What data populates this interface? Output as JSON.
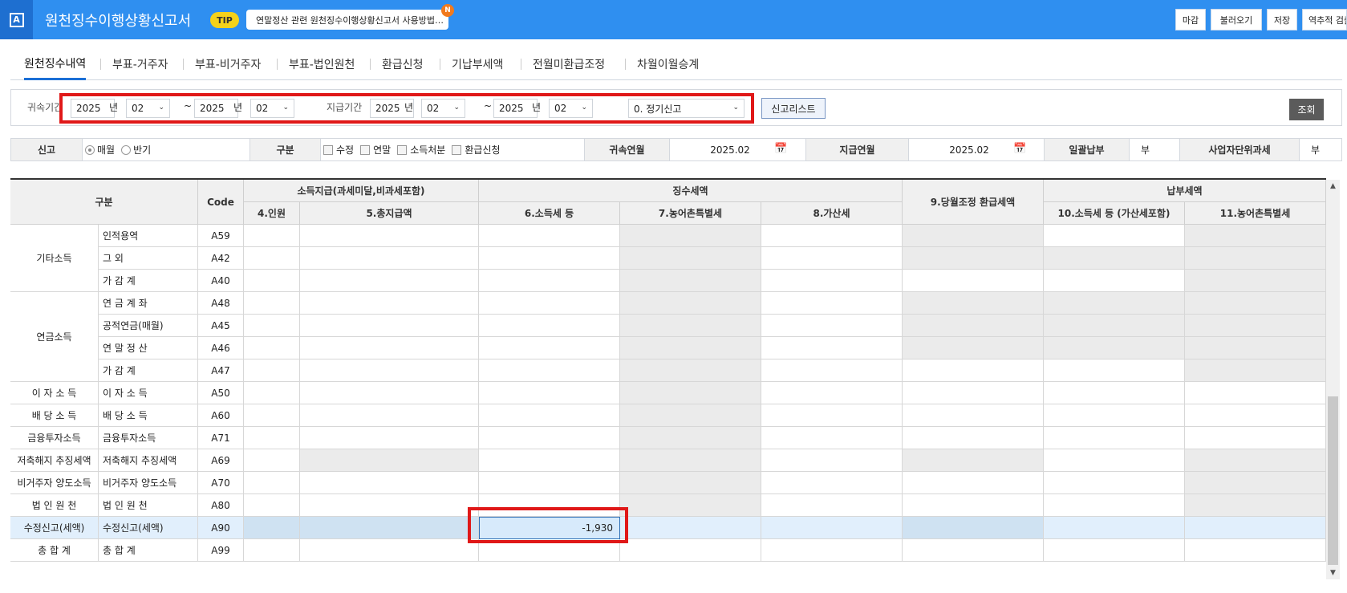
{
  "app": {
    "title": "원천징수이행상황신고서",
    "logo": "A",
    "tip_badge": "TIP",
    "tip_text": "연말정산 관련 원천징수이행상황신고서 사용방법…",
    "notice_badge": "N"
  },
  "toolbar": {
    "close_label": "마감",
    "load_label": "불러오기",
    "save_label": "저장",
    "reverse_label": "역추적 검출"
  },
  "tabs": [
    "원천징수내역",
    "부표-거주자",
    "부표-비거주자",
    "부표-법인원천",
    "환급신청",
    "기납부세액",
    "전월미환급조정",
    "차월이월승계"
  ],
  "filter": {
    "belong_label": "귀속기간",
    "year_unit": "년",
    "tilde": "~",
    "belong_from_year": "2025",
    "belong_from_month": "02",
    "belong_to_year": "2025",
    "belong_to_month": "02",
    "pay_label": "지급기간",
    "pay_from_year": "2025",
    "pay_from_month": "02",
    "pay_to_year": "2025",
    "pay_to_month": "02",
    "report_type": "0. 정기신고",
    "report_list_button": "신고리스트",
    "search_button": "조회"
  },
  "conditions": {
    "report_label": "신고",
    "monthly": "매월",
    "semiannual": "반기",
    "category_label": "구분",
    "amend": "수정",
    "yearend": "연말",
    "income_disposal": "소득처분",
    "refund": "환급신청",
    "belong_month_label": "귀속연월",
    "belong_month": "2025.02",
    "pay_month_label": "지급연월",
    "pay_month": "2025.02",
    "bulk_label": "일괄납부",
    "bulk_value": "부",
    "unit_tax_label": "사업자단위과세",
    "unit_tax_value": "부"
  },
  "grid": {
    "headers": {
      "category": "구분",
      "code": "Code",
      "income_group": "소득지급(과세미달,비과세포함)",
      "tax_group": "징수세액",
      "adjust": "9.당월조정 환급세액",
      "pay_group": "납부세액",
      "c4": "4.인원",
      "c5": "5.총지급액",
      "c6": "6.소득세 등",
      "c7": "7.농어촌특별세",
      "c8": "8.가산세",
      "c10": "10.소득세 등 (가산세포함)",
      "c11": "11.농어촌특별세"
    },
    "groups": [
      {
        "label": "기타소득",
        "rows": [
          {
            "sub": "인적용역",
            "code": "A59"
          },
          {
            "sub": "그 외",
            "code": "A42"
          },
          {
            "sub": "가 감 계",
            "code": "A40"
          }
        ]
      },
      {
        "label": "연금소득",
        "rows": [
          {
            "sub": "연 금 계 좌",
            "code": "A48"
          },
          {
            "sub": "공적연금(매월)",
            "code": "A45"
          },
          {
            "sub": "연 말 정 산",
            "code": "A46"
          },
          {
            "sub": "가 감 계",
            "code": "A47"
          }
        ]
      }
    ],
    "single_rows": [
      {
        "main": "이 자 소 득",
        "sub": "이 자 소 득",
        "code": "A50"
      },
      {
        "main": "배 당 소 득",
        "sub": "배 당 소 득",
        "code": "A60"
      },
      {
        "main": "금융투자소득",
        "sub": "금융투자소득",
        "code": "A71"
      },
      {
        "main": "저축해지 추징세액",
        "sub": "저축해지 추징세액",
        "code": "A69"
      },
      {
        "main": "비거주자 양도소득",
        "sub": "비거주자 양도소득",
        "code": "A70"
      },
      {
        "main": "법 인 원 천",
        "sub": "법 인 원 천",
        "code": "A80"
      },
      {
        "main": "수정신고(세액)",
        "sub": "수정신고(세액)",
        "code": "A90",
        "c6": "-1,930"
      },
      {
        "main": "총 합 계",
        "sub": "총 합 계",
        "code": "A99"
      }
    ]
  }
}
